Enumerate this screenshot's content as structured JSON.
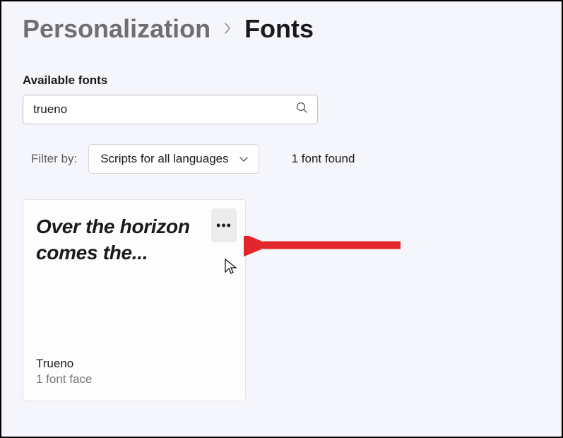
{
  "breadcrumb": {
    "parent": "Personalization",
    "current": "Fonts"
  },
  "section": {
    "title": "Available fonts"
  },
  "search": {
    "value": "trueno"
  },
  "filter": {
    "label": "Filter by:",
    "selected": "Scripts for all languages"
  },
  "results": {
    "count_text": "1 font found"
  },
  "card": {
    "preview_text": "Over the horizon comes the...",
    "name": "Trueno",
    "faces": "1 font face"
  }
}
